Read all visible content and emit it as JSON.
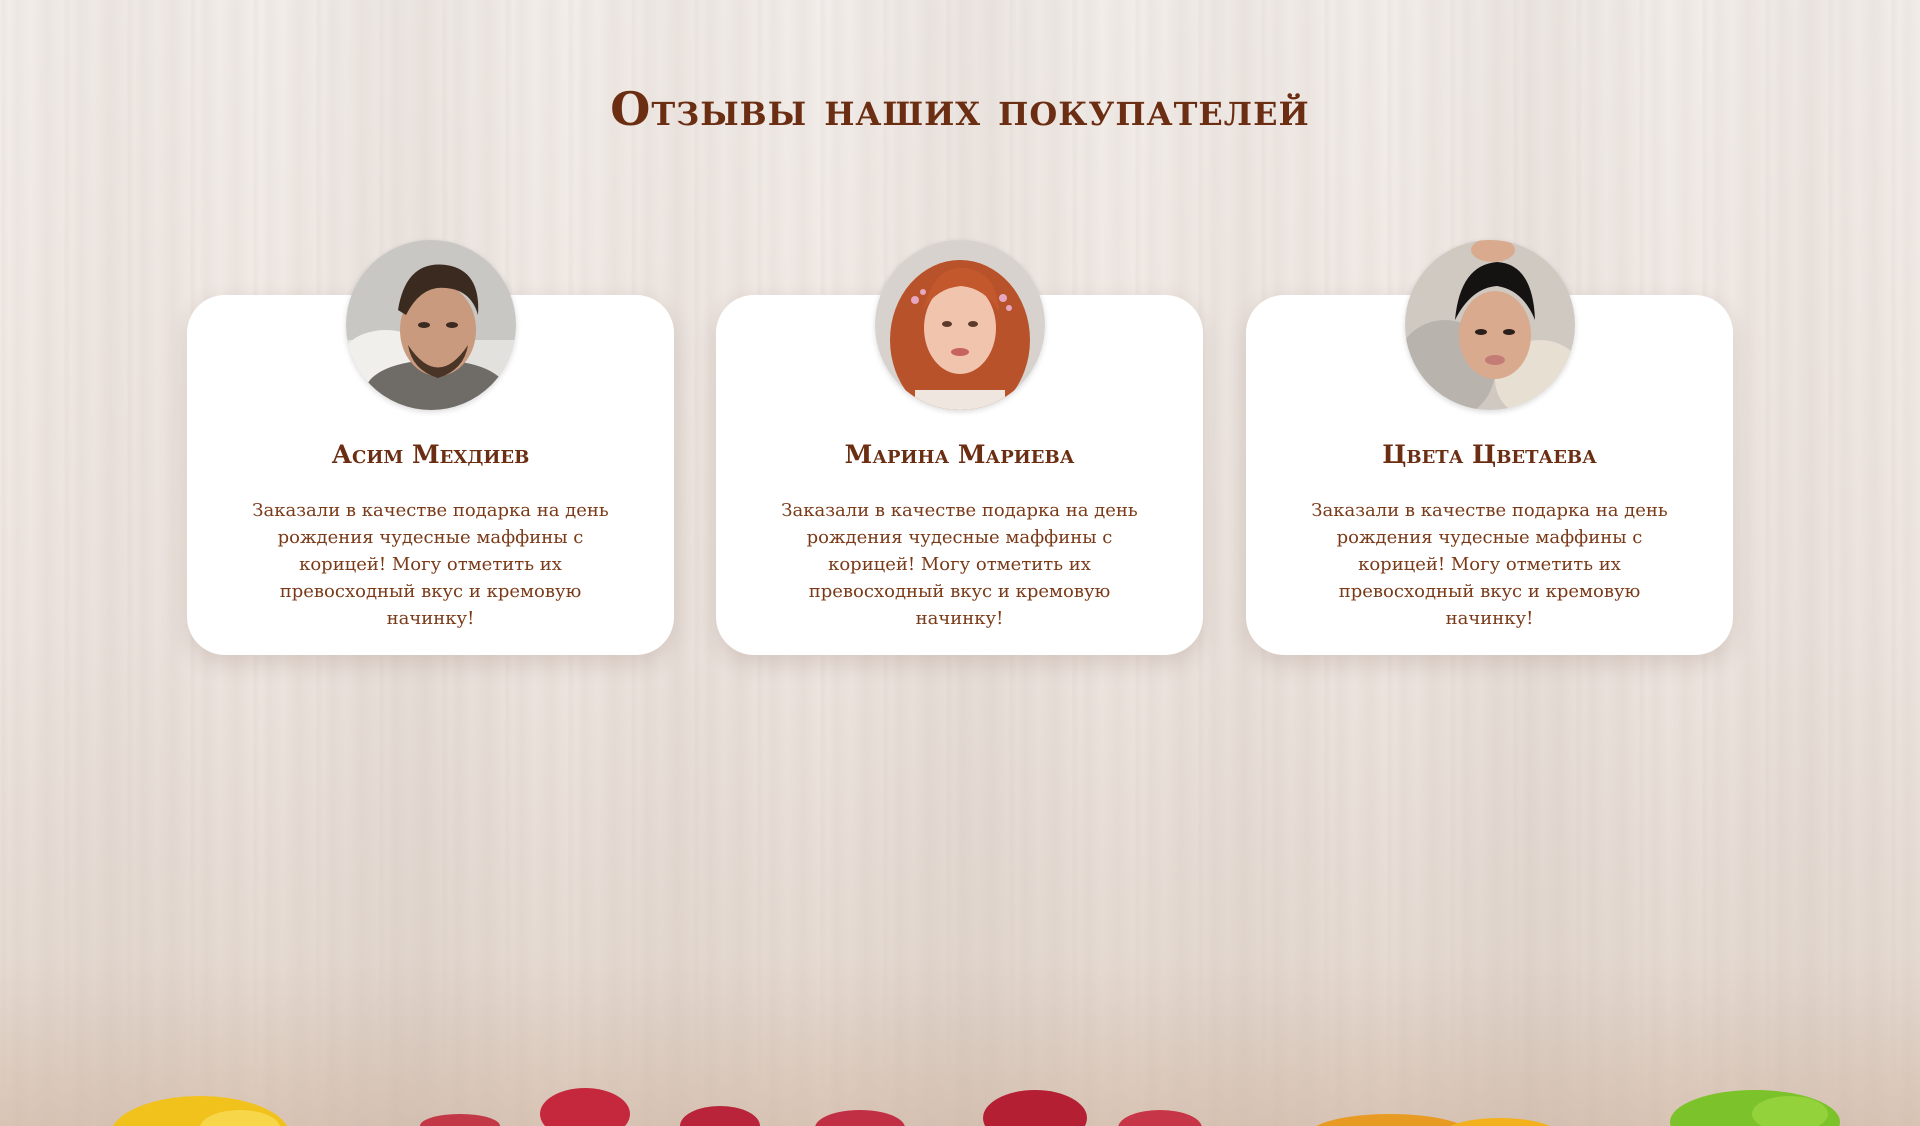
{
  "section": {
    "title": "Отзывы наших покупателей"
  },
  "reviews": [
    {
      "name": "Асим Мехдиев",
      "text": "Заказали в качестве подарка на день рождения чудесные маффины с корицей! Могу отметить их превосходный вкус и кремовую начинку!",
      "avatar": "avatar-man-dark-hair"
    },
    {
      "name": "Марина Мариева",
      "text": "Заказали в качестве подарка на день рождения чудесные маффины с корицей! Могу отметить их превосходный вкус и кремовую начинку!",
      "avatar": "avatar-woman-red-hair"
    },
    {
      "name": "Цвета Цветаева",
      "text": "Заказали в качестве подарка на день рождения чудесные маффины с корицей! Могу отметить их превосходный вкус и кремовую начинку!",
      "avatar": "avatar-woman-black-hair"
    }
  ],
  "colors": {
    "accent": "#6b2e12",
    "card": "#ffffff",
    "background": "#f1ebe7"
  }
}
